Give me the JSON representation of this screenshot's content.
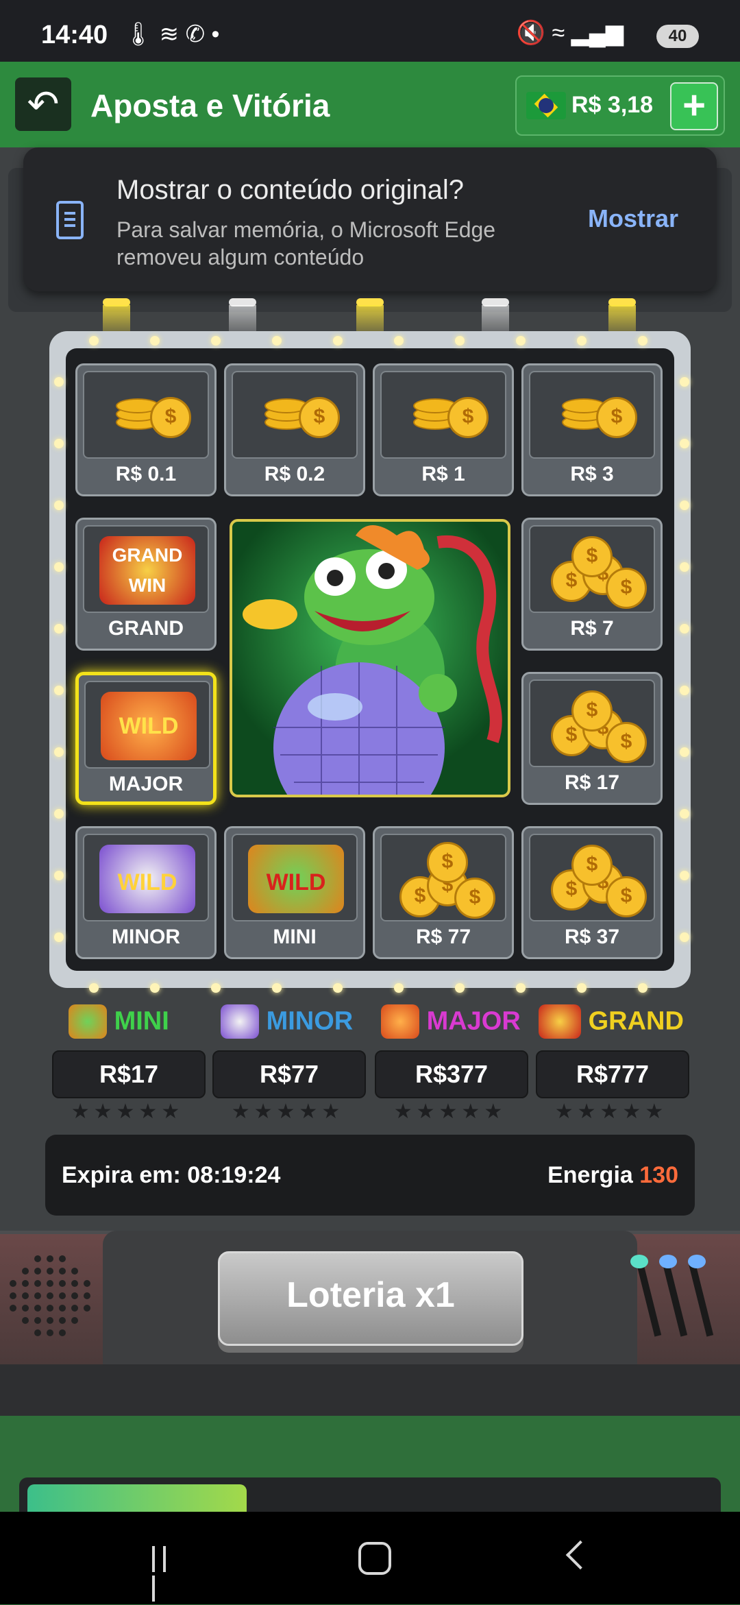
{
  "status_bar": {
    "time": "14:40",
    "left_icons": [
      "thermometer-icon",
      "signal-icon",
      "whatsapp-icon",
      "dot-icon"
    ],
    "right_icons": [
      "mute-icon",
      "wifi-icon",
      "cell-signal-icon"
    ],
    "battery": "40"
  },
  "header": {
    "title": "Aposta e Vitória",
    "balance": "R$ 3,18",
    "add_label": "+"
  },
  "edge_prompt": {
    "title": "Mostrar o conteúdo original?",
    "subtitle": "Para salvar memória, o Microsoft Edge removeu algum conteúdo",
    "button": "Mostrar"
  },
  "board": {
    "tiles": [
      {
        "label": "R$ 0.1"
      },
      {
        "label": "R$ 0.2"
      },
      {
        "label": "R$ 1"
      },
      {
        "label": "R$ 3"
      },
      {
        "label": "GRAND"
      },
      {
        "label": "R$ 7"
      },
      {
        "label": "MAJOR"
      },
      {
        "label": "R$ 17"
      },
      {
        "label": "MINOR"
      },
      {
        "label": "MINI"
      },
      {
        "label": "R$ 77"
      },
      {
        "label": "R$ 37"
      }
    ],
    "selected": "MAJOR",
    "badges": {
      "grand": "GRAND WIN",
      "wild": "WILD"
    }
  },
  "jackpots": [
    {
      "name": "MINI",
      "value": "R$17",
      "color": "#3fd14b"
    },
    {
      "name": "MINOR",
      "value": "R$77",
      "color": "#3b9be0"
    },
    {
      "name": "MAJOR",
      "value": "R$377",
      "color": "#d93ad1"
    },
    {
      "name": "GRAND",
      "value": "R$777",
      "color": "#f0d020"
    }
  ],
  "stars": "★★★★★",
  "info": {
    "expira": "Expira em: 08:19:24",
    "energia_label": "Energia",
    "energia_value": "130"
  },
  "action_button": "Loteria x1",
  "progress": 0.32
}
